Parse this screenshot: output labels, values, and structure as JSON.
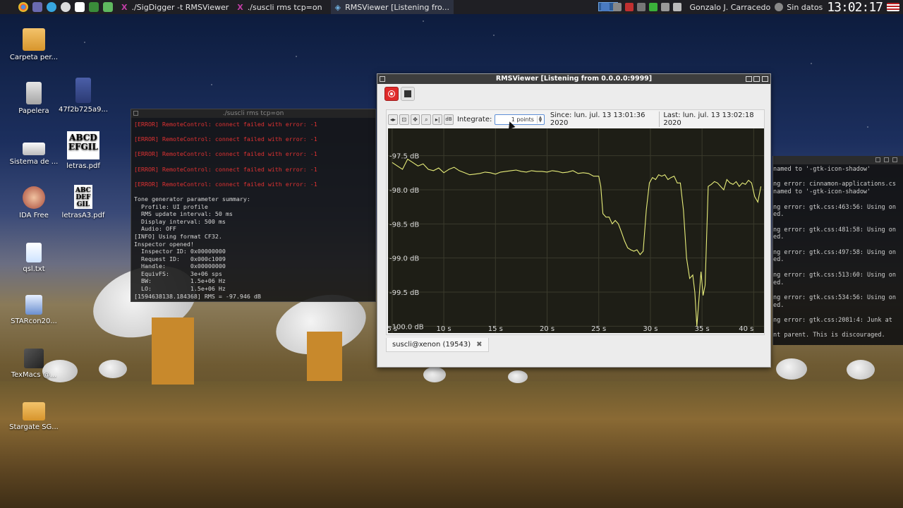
{
  "taskbar": {
    "tasks": [
      {
        "label": "./SigDigger -t RMSViewer",
        "icon": "terminal-icon"
      },
      {
        "label": "./suscli rms tcp=on",
        "icon": "terminal-icon"
      },
      {
        "label": "RMSViewer [Listening fro...",
        "icon": "app-icon"
      }
    ],
    "user": "Gonzalo J. Carracedo",
    "network": "Sin datos",
    "clock": "13:02:17"
  },
  "desktop": {
    "icons": [
      {
        "label": "Carpeta per...",
        "icon": "folder-icon"
      },
      {
        "label": "Papelera",
        "icon": "trash-icon"
      },
      {
        "label": "47f2b725a9...",
        "icon": "book-icon"
      },
      {
        "label": "Sistema de ...",
        "icon": "drive-icon"
      },
      {
        "label": "letras.pdf",
        "icon": "pdf-icon"
      },
      {
        "label": "IDA Free",
        "icon": "ida-icon"
      },
      {
        "label": "letrasA3.pdf",
        "icon": "pdf-icon"
      },
      {
        "label": "qsl.txt",
        "icon": "text-file-icon"
      },
      {
        "label": "STARcon20...",
        "icon": "star-icon"
      },
      {
        "label": "TexMacs @...",
        "icon": "texmacs-icon"
      },
      {
        "label": "Stargate SG...",
        "icon": "folder-icon"
      }
    ],
    "pdf_glyphs": {
      "letras": "ABCD EFGIL",
      "letrasA3": "ABC DEF GIL"
    }
  },
  "terminal": {
    "title": "./suscli rms tcp=on",
    "errors": [
      "[ERROR] RemoteControl: connect failed with error: -1",
      "[ERROR] RemoteControl: connect failed with error: -1",
      "[ERROR] RemoteControl: connect failed with error: -1",
      "[ERROR] RemoteControl: connect failed with error: -1",
      "[ERROR] RemoteControl: connect failed with error: -1"
    ],
    "lines": [
      "Tone generator parameter summary:",
      "  Profile: UI profile",
      "  RMS update interval: 50 ms",
      "  Display interval: 500 ms",
      "  Audio: OFF",
      "[INFO] Using format CF32.",
      "Inspector opened!",
      "  Inspector ID: 0x00000000",
      "  Request ID:   0x000c1009",
      "  Handle:       0x00000000",
      "  EquivFS:      3e+06 sps",
      "  BW:           1.5e+06 Hz",
      "  LO:           1.5e+06 Hz",
      "[1594638138.184368] RMS = -97.946 dB"
    ]
  },
  "terminal2": {
    "lines": [
      "named to '-gtk-icon-shadow'",
      "",
      "ng error: cinnamon-applications.cs",
      "named to '-gtk-icon-shadow'",
      "",
      "ng error: gtk.css:463:56: Using on",
      "ed.",
      "",
      "ng error: gtk.css:481:58: Using on",
      "ed.",
      "",
      "ng error: gtk.css:497:58: Using on",
      "ed.",
      "",
      "ng error: gtk.css:513:60: Using on",
      "ed.",
      "",
      "ng error: gtk.css:534:56: Using on",
      "ed.",
      "",
      "ng error: gtk.css:2081:4: Junk at",
      "",
      "nt parent. This is discouraged."
    ]
  },
  "rms": {
    "title": "RMSViewer [Listening from 0.0.0.0:9999]",
    "integrate_label": "Integrate:",
    "integrate_value": "1 points",
    "since": "Since: lun. jul. 13 13:01:36 2020",
    "last": "Last: lun. jul. 13 13:02:18 2020",
    "tab_label": "suscli@xenon (19543)",
    "db_button": "dB",
    "colors": {
      "trace": "#e8ee7a",
      "plot_bg": "#1e1e16",
      "grid": "#3a3a2c"
    }
  },
  "chart_data": {
    "type": "line",
    "xlabel": "",
    "ylabel": "",
    "xlim": [
      4.6,
      41.0
    ],
    "ylim": [
      -100.1,
      -97.1
    ],
    "x_ticks": [
      "5 s",
      "10 s",
      "15 s",
      "20 s",
      "25 s",
      "30 s",
      "35 s",
      "40 s"
    ],
    "y_ticks": [
      "-97.5 dB",
      "-98.0 dB",
      "-98.5 dB",
      "-99.0 dB",
      "-99.5 dB",
      "-100.0 dB"
    ],
    "x_tick_values": [
      5,
      10,
      15,
      20,
      25,
      30,
      35,
      40
    ],
    "y_tick_values": [
      -97.5,
      -98.0,
      -98.5,
      -99.0,
      -99.5,
      -100.0
    ],
    "series": [
      {
        "x": [
          5.0,
          5.5,
          6.0,
          6.5,
          7.0,
          7.5,
          8.0,
          8.5,
          9.0,
          9.5,
          10.0,
          10.5,
          11.0,
          11.5,
          12.0,
          12.5,
          13.0,
          13.5,
          14.0,
          14.5,
          15.0,
          15.5,
          16.0,
          16.5,
          17.0,
          17.5,
          18.0,
          18.5,
          19.0,
          19.5,
          20.0,
          20.5,
          21.0,
          21.5,
          22.0,
          22.5,
          23.0,
          23.5,
          24.0,
          24.5,
          25.0,
          25.2,
          25.4,
          25.7,
          26.0,
          26.3,
          26.6,
          26.9,
          27.2,
          27.5,
          27.8,
          28.1,
          28.4,
          28.7,
          29.0,
          29.3,
          29.6,
          29.9,
          30.2,
          30.5,
          30.8,
          31.1,
          31.4,
          31.7,
          32.0,
          32.3,
          32.6,
          32.9,
          33.2,
          33.5,
          33.8,
          34.1,
          34.3,
          34.5,
          34.7,
          34.9,
          35.1,
          35.3,
          35.6,
          35.9,
          36.2,
          36.5,
          36.8,
          37.1,
          37.4,
          37.7,
          38.0,
          38.3,
          38.6,
          38.9,
          39.2,
          39.5,
          39.8,
          40.1,
          40.4,
          40.7
        ],
        "y": [
          -97.6,
          -97.65,
          -97.7,
          -97.55,
          -97.6,
          -97.65,
          -97.62,
          -97.7,
          -97.72,
          -97.68,
          -97.75,
          -97.7,
          -97.67,
          -97.72,
          -97.75,
          -97.78,
          -97.77,
          -97.76,
          -97.74,
          -97.75,
          -97.77,
          -97.74,
          -97.73,
          -97.72,
          -97.71,
          -97.73,
          -97.74,
          -97.72,
          -97.73,
          -97.73,
          -97.74,
          -97.72,
          -97.73,
          -97.75,
          -97.74,
          -97.72,
          -97.76,
          -97.75,
          -97.76,
          -97.8,
          -97.8,
          -97.95,
          -98.35,
          -98.4,
          -98.4,
          -98.5,
          -98.45,
          -98.5,
          -98.62,
          -98.75,
          -98.85,
          -98.88,
          -98.9,
          -98.88,
          -98.95,
          -98.9,
          -98.3,
          -97.9,
          -97.82,
          -97.85,
          -97.78,
          -97.8,
          -97.78,
          -97.85,
          -97.82,
          -97.8,
          -97.9,
          -97.9,
          -98.3,
          -99.0,
          -99.3,
          -99.25,
          -99.5,
          -100.0,
          -99.6,
          -99.2,
          -99.55,
          -99.4,
          -97.95,
          -97.92,
          -97.88,
          -97.9,
          -97.95,
          -98.0,
          -97.85,
          -97.9,
          -97.92,
          -97.88,
          -97.95,
          -97.9,
          -97.92,
          -97.86,
          -97.9,
          -98.1,
          -98.18,
          -97.95
        ]
      }
    ],
    "grid": true
  }
}
